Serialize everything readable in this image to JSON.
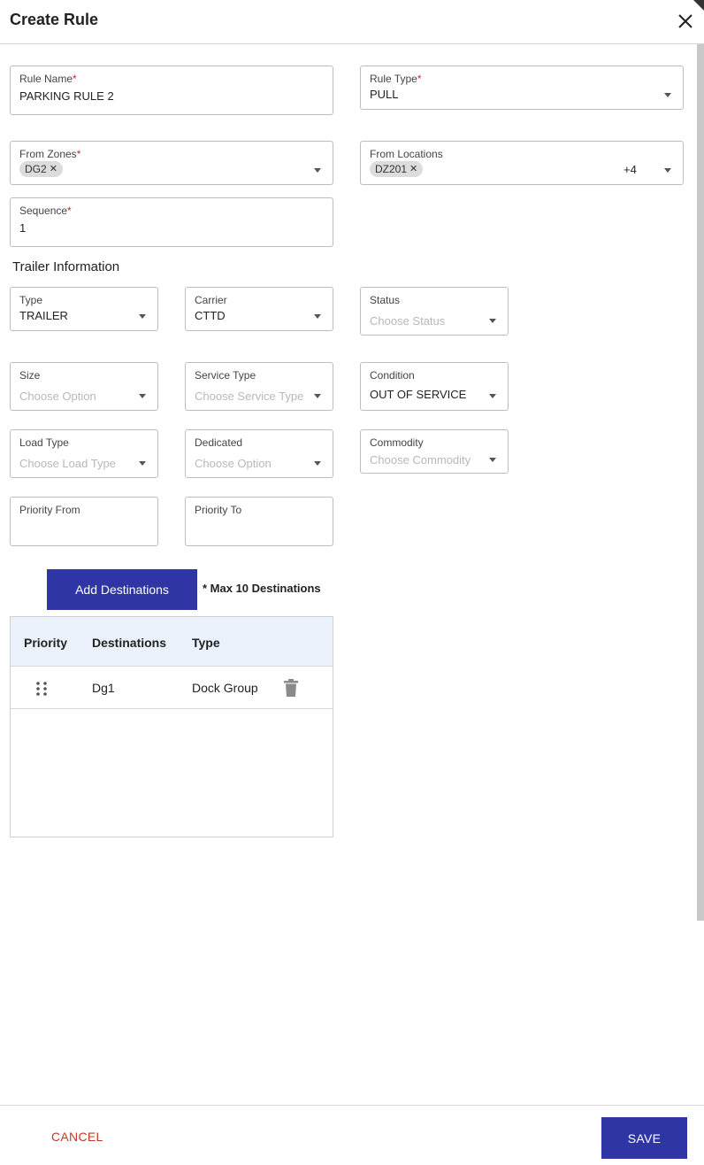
{
  "dialog": {
    "title": "Create Rule"
  },
  "rule_name": {
    "label": "Rule Name",
    "required": "*",
    "value": "PARKING RULE 2"
  },
  "rule_type": {
    "label": "Rule Type",
    "required": "*",
    "value": "PULL"
  },
  "from_zones": {
    "label": "From Zones",
    "required": "*",
    "chips": [
      "DG2"
    ]
  },
  "from_locations": {
    "label": "From Locations",
    "chips": [
      "DZ201"
    ],
    "more": "+4"
  },
  "sequence": {
    "label": "Sequence",
    "required": "*",
    "value": "1"
  },
  "trailer_section": {
    "title": "Trailer Information"
  },
  "type_field": {
    "label": "Type",
    "value": "TRAILER"
  },
  "carrier_field": {
    "label": "Carrier",
    "value": "CTTD"
  },
  "status_field": {
    "label": "Status",
    "placeholder": "Choose Status"
  },
  "size_field": {
    "label": "Size",
    "placeholder": "Choose Option"
  },
  "service_type_field": {
    "label": "Service Type",
    "placeholder": "Choose Service Type"
  },
  "condition_field": {
    "label": "Condition",
    "value": "OUT OF SERVICE"
  },
  "load_type_field": {
    "label": "Load Type",
    "placeholder": "Choose Load Type"
  },
  "dedicated_field": {
    "label": "Dedicated",
    "placeholder": "Choose Option"
  },
  "commodity_field": {
    "label": "Commodity",
    "placeholder": "Choose Commodity"
  },
  "priority_from_field": {
    "label": "Priority From",
    "value": ""
  },
  "priority_to_field": {
    "label": "Priority To",
    "value": ""
  },
  "destinations": {
    "add_button": "Add Destinations",
    "max_note": "* Max 10 Destinations",
    "columns": [
      "Priority",
      "Destinations",
      "Type"
    ],
    "rows": [
      {
        "destination": "Dg1",
        "type": "Dock Group"
      }
    ]
  },
  "footer": {
    "cancel": "CANCEL",
    "save": "SAVE"
  },
  "colors": {
    "primary": "#2f35a5",
    "danger": "#c0392b",
    "required": "#c62828",
    "table_header": "#eaf1fb"
  },
  "icons": [
    "close-icon",
    "dropdown-arrow-icon",
    "chip-remove-icon",
    "drag-handle-icon",
    "trash-icon"
  ]
}
